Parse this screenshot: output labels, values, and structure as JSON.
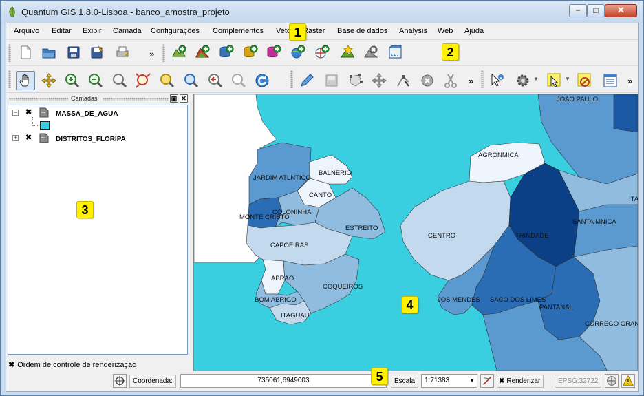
{
  "window": {
    "title": "Quantum GIS 1.8.0-Lisboa - banco_amostra_projeto",
    "minimize_glyph": "−",
    "maximize_glyph": "□",
    "close_glyph": "✕"
  },
  "menubar": {
    "items": [
      "Arquivo",
      "Editar",
      "Exibir",
      "Camada",
      "Configurações",
      "Complementos",
      "Vetor",
      "Raster",
      "Base de dados",
      "Analysis",
      "Web",
      "Ajuda"
    ]
  },
  "toolbar_file": {
    "icons": [
      "new-project-icon",
      "open-project-icon",
      "save-project-icon",
      "save-as-icon",
      "print-composer-icon"
    ],
    "more_glyph": "»"
  },
  "toolbar_layers": {
    "icons": [
      "add-vector-layer-icon",
      "add-raster-layer-icon",
      "add-postgis-layer-icon",
      "add-spatialite-layer-icon",
      "add-mssql-layer-icon",
      "add-wms-layer-icon",
      "add-wfs-layer-icon",
      "new-shapefile-icon",
      "remove-layer-icon",
      "add-delimited-text-icon"
    ]
  },
  "toolbar_nav": {
    "icons": [
      "pan-icon",
      "pan-to-selection-icon",
      "zoom-in-icon",
      "zoom-out-icon",
      "zoom-full-icon",
      "zoom-to-selection-icon",
      "zoom-to-layer-icon",
      "zoom-actual-size-icon",
      "zoom-last-icon",
      "zoom-next-icon",
      "refresh-icon"
    ],
    "edit_icons": [
      "toggle-editing-icon",
      "save-edits-icon",
      "capture-polygon-icon",
      "move-feature-icon",
      "node-tool-icon",
      "delete-selected-icon",
      "cut-features-icon"
    ],
    "attr_icons": [
      "identify-icon",
      "actions-icon",
      "select-icon",
      "deselect-icon",
      "attribute-table-icon"
    ],
    "more_glyph": "»"
  },
  "layers_panel": {
    "title": "Camadas",
    "float_glyph": "▣",
    "close_glyph": "✕",
    "layers": [
      {
        "name": "MASSA_DE_AGUA",
        "expanded": true,
        "checked": true,
        "expander": "−",
        "check_glyph": "✖",
        "swatch_color": "#39cfe0"
      },
      {
        "name": "DISTRITOS_FLORIPA",
        "expanded": false,
        "checked": true,
        "expander": "+",
        "check_glyph": "✖"
      }
    ],
    "render_order_label": "Ordem de controle de renderização",
    "render_order_check": "✖"
  },
  "map": {
    "water_color": "#39cfe0",
    "labels": [
      "JOÃO PAULO",
      "AGRONMICA",
      "BALNERIO",
      "JARDIM ATLNTICO",
      "CANTO",
      "COLONINHA",
      "MONTE CRISTO",
      "ESTREITO",
      "CENTRO",
      "TRINDADE",
      "SANTA MNICA",
      "ITA",
      "CAPOEIRAS",
      "ABRAO",
      "COQUEIROS",
      "BOM ABRIGO",
      "ITAGUAU",
      "JOS MENDES",
      "SACO DOS LIMES",
      "PANTANAL",
      "CORREGO GRAN"
    ],
    "class_colors": [
      "#eef4fb",
      "#c3d9ee",
      "#8fbcdf",
      "#5b9ad0",
      "#2a6db5",
      "#0b3f86"
    ]
  },
  "statusbar": {
    "coord_label": "Coordenada:",
    "coord_value": "735061,6949003",
    "scale_label": "Escala",
    "scale_value": "1:71383",
    "render_label": "Renderizar",
    "render_check": "✖",
    "crs": "EPSG:32722",
    "dropdown_glyph": "▼"
  },
  "callouts": [
    "1",
    "2",
    "3",
    "4",
    "5"
  ]
}
